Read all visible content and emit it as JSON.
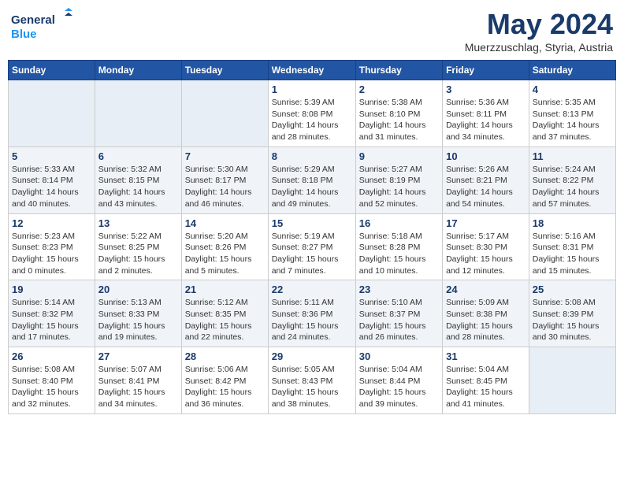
{
  "header": {
    "logo_line1": "General",
    "logo_line2": "Blue",
    "month_title": "May 2024",
    "subtitle": "Muerzzuschlag, Styria, Austria"
  },
  "weekdays": [
    "Sunday",
    "Monday",
    "Tuesday",
    "Wednesday",
    "Thursday",
    "Friday",
    "Saturday"
  ],
  "weeks": [
    [
      {
        "num": "",
        "info": ""
      },
      {
        "num": "",
        "info": ""
      },
      {
        "num": "",
        "info": ""
      },
      {
        "num": "1",
        "info": "Sunrise: 5:39 AM\nSunset: 8:08 PM\nDaylight: 14 hours\nand 28 minutes."
      },
      {
        "num": "2",
        "info": "Sunrise: 5:38 AM\nSunset: 8:10 PM\nDaylight: 14 hours\nand 31 minutes."
      },
      {
        "num": "3",
        "info": "Sunrise: 5:36 AM\nSunset: 8:11 PM\nDaylight: 14 hours\nand 34 minutes."
      },
      {
        "num": "4",
        "info": "Sunrise: 5:35 AM\nSunset: 8:13 PM\nDaylight: 14 hours\nand 37 minutes."
      }
    ],
    [
      {
        "num": "5",
        "info": "Sunrise: 5:33 AM\nSunset: 8:14 PM\nDaylight: 14 hours\nand 40 minutes."
      },
      {
        "num": "6",
        "info": "Sunrise: 5:32 AM\nSunset: 8:15 PM\nDaylight: 14 hours\nand 43 minutes."
      },
      {
        "num": "7",
        "info": "Sunrise: 5:30 AM\nSunset: 8:17 PM\nDaylight: 14 hours\nand 46 minutes."
      },
      {
        "num": "8",
        "info": "Sunrise: 5:29 AM\nSunset: 8:18 PM\nDaylight: 14 hours\nand 49 minutes."
      },
      {
        "num": "9",
        "info": "Sunrise: 5:27 AM\nSunset: 8:19 PM\nDaylight: 14 hours\nand 52 minutes."
      },
      {
        "num": "10",
        "info": "Sunrise: 5:26 AM\nSunset: 8:21 PM\nDaylight: 14 hours\nand 54 minutes."
      },
      {
        "num": "11",
        "info": "Sunrise: 5:24 AM\nSunset: 8:22 PM\nDaylight: 14 hours\nand 57 minutes."
      }
    ],
    [
      {
        "num": "12",
        "info": "Sunrise: 5:23 AM\nSunset: 8:23 PM\nDaylight: 15 hours\nand 0 minutes."
      },
      {
        "num": "13",
        "info": "Sunrise: 5:22 AM\nSunset: 8:25 PM\nDaylight: 15 hours\nand 2 minutes."
      },
      {
        "num": "14",
        "info": "Sunrise: 5:20 AM\nSunset: 8:26 PM\nDaylight: 15 hours\nand 5 minutes."
      },
      {
        "num": "15",
        "info": "Sunrise: 5:19 AM\nSunset: 8:27 PM\nDaylight: 15 hours\nand 7 minutes."
      },
      {
        "num": "16",
        "info": "Sunrise: 5:18 AM\nSunset: 8:28 PM\nDaylight: 15 hours\nand 10 minutes."
      },
      {
        "num": "17",
        "info": "Sunrise: 5:17 AM\nSunset: 8:30 PM\nDaylight: 15 hours\nand 12 minutes."
      },
      {
        "num": "18",
        "info": "Sunrise: 5:16 AM\nSunset: 8:31 PM\nDaylight: 15 hours\nand 15 minutes."
      }
    ],
    [
      {
        "num": "19",
        "info": "Sunrise: 5:14 AM\nSunset: 8:32 PM\nDaylight: 15 hours\nand 17 minutes."
      },
      {
        "num": "20",
        "info": "Sunrise: 5:13 AM\nSunset: 8:33 PM\nDaylight: 15 hours\nand 19 minutes."
      },
      {
        "num": "21",
        "info": "Sunrise: 5:12 AM\nSunset: 8:35 PM\nDaylight: 15 hours\nand 22 minutes."
      },
      {
        "num": "22",
        "info": "Sunrise: 5:11 AM\nSunset: 8:36 PM\nDaylight: 15 hours\nand 24 minutes."
      },
      {
        "num": "23",
        "info": "Sunrise: 5:10 AM\nSunset: 8:37 PM\nDaylight: 15 hours\nand 26 minutes."
      },
      {
        "num": "24",
        "info": "Sunrise: 5:09 AM\nSunset: 8:38 PM\nDaylight: 15 hours\nand 28 minutes."
      },
      {
        "num": "25",
        "info": "Sunrise: 5:08 AM\nSunset: 8:39 PM\nDaylight: 15 hours\nand 30 minutes."
      }
    ],
    [
      {
        "num": "26",
        "info": "Sunrise: 5:08 AM\nSunset: 8:40 PM\nDaylight: 15 hours\nand 32 minutes."
      },
      {
        "num": "27",
        "info": "Sunrise: 5:07 AM\nSunset: 8:41 PM\nDaylight: 15 hours\nand 34 minutes."
      },
      {
        "num": "28",
        "info": "Sunrise: 5:06 AM\nSunset: 8:42 PM\nDaylight: 15 hours\nand 36 minutes."
      },
      {
        "num": "29",
        "info": "Sunrise: 5:05 AM\nSunset: 8:43 PM\nDaylight: 15 hours\nand 38 minutes."
      },
      {
        "num": "30",
        "info": "Sunrise: 5:04 AM\nSunset: 8:44 PM\nDaylight: 15 hours\nand 39 minutes."
      },
      {
        "num": "31",
        "info": "Sunrise: 5:04 AM\nSunset: 8:45 PM\nDaylight: 15 hours\nand 41 minutes."
      },
      {
        "num": "",
        "info": ""
      }
    ]
  ]
}
